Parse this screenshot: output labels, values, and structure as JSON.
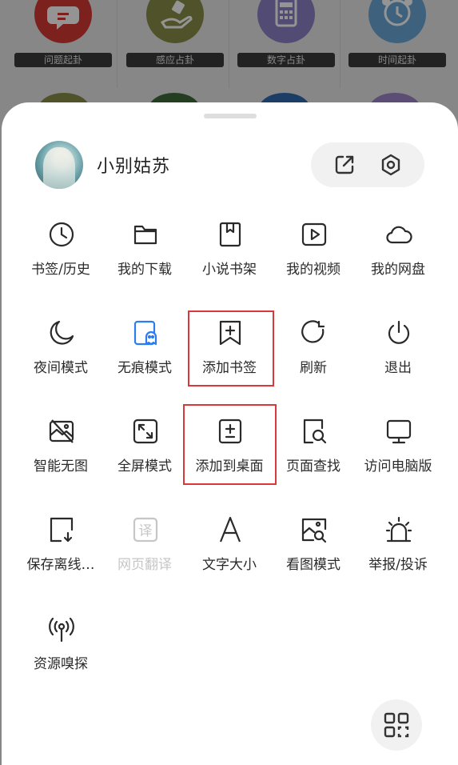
{
  "background": {
    "items": [
      {
        "label": "问题起卦",
        "color": "#d83a34",
        "icon": "chat-bubble-icon"
      },
      {
        "label": "感应占卦",
        "color": "#8b8d48",
        "icon": "hand-icon"
      },
      {
        "label": "数字占卦",
        "color": "#8e84c9",
        "icon": "calculator-icon"
      },
      {
        "label": "时间起卦",
        "color": "#6ba7d8",
        "icon": "alarm-clock-icon"
      }
    ]
  },
  "profile": {
    "name": "小别姑苏"
  },
  "header_actions": [
    {
      "icon": "share-icon"
    },
    {
      "icon": "settings-icon"
    }
  ],
  "menu": [
    {
      "label": "书签/历史",
      "icon": "clock-icon",
      "enabled": true
    },
    {
      "label": "我的下载",
      "icon": "folder-icon",
      "enabled": true
    },
    {
      "label": "小说书架",
      "icon": "bookshelf-icon",
      "enabled": true
    },
    {
      "label": "我的视频",
      "icon": "video-play-icon",
      "enabled": true
    },
    {
      "label": "我的网盘",
      "icon": "cloud-icon",
      "enabled": true
    },
    {
      "label": "夜间模式",
      "icon": "moon-icon",
      "enabled": true
    },
    {
      "label": "无痕模式",
      "icon": "ghost-icon",
      "enabled": true,
      "active": true
    },
    {
      "label": "添加书签",
      "icon": "bookmark-add-icon",
      "enabled": true,
      "highlighted": true
    },
    {
      "label": "刷新",
      "icon": "refresh-icon",
      "enabled": true
    },
    {
      "label": "退出",
      "icon": "power-icon",
      "enabled": true
    },
    {
      "label": "智能无图",
      "icon": "no-image-icon",
      "enabled": true
    },
    {
      "label": "全屏模式",
      "icon": "fullscreen-icon",
      "enabled": true
    },
    {
      "label": "添加到桌面",
      "icon": "add-to-desktop-icon",
      "enabled": true,
      "highlighted": true
    },
    {
      "label": "页面查找",
      "icon": "page-search-icon",
      "enabled": true
    },
    {
      "label": "访问电脑版",
      "icon": "monitor-icon",
      "enabled": true
    },
    {
      "label": "保存离线…",
      "icon": "save-offline-icon",
      "enabled": true
    },
    {
      "label": "网页翻译",
      "icon": "translate-icon",
      "enabled": false
    },
    {
      "label": "文字大小",
      "icon": "text-size-icon",
      "enabled": true
    },
    {
      "label": "看图模式",
      "icon": "image-view-icon",
      "enabled": true
    },
    {
      "label": "举报/投诉",
      "icon": "alarm-light-icon",
      "enabled": true
    },
    {
      "label": "资源嗅探",
      "icon": "signal-tower-icon",
      "enabled": true
    }
  ],
  "footer": {
    "icon": "grid-apps-icon"
  },
  "colors": {
    "highlight": "#d9393a",
    "active_icon": "#2b7cf0",
    "disabled": "#c6c6c6"
  }
}
